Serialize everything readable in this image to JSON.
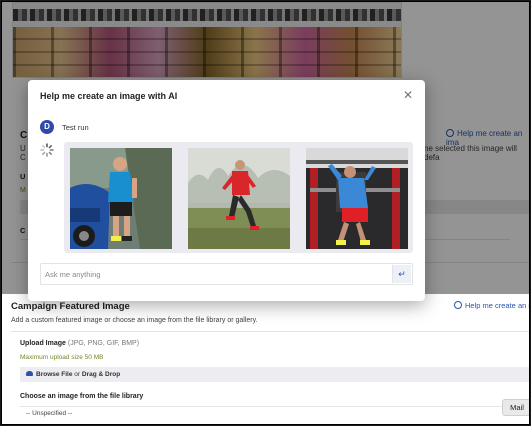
{
  "modal": {
    "title": "Help me create an image with AI",
    "close_icon": "close-icon",
    "user": {
      "avatar_letter": "D",
      "message": "Test run"
    },
    "loading_icon": "spinner-icon",
    "images": [
      {
        "subject": "runner-leaning-on-car"
      },
      {
        "subject": "runner-in-field"
      },
      {
        "subject": "athlete-with-barbell"
      }
    ],
    "input": {
      "placeholder": "Ask me anything",
      "value": ""
    },
    "send_icon": "enter-icon"
  },
  "background": {
    "section_heading_fragment": "C",
    "ai_link": "Help me create an ima",
    "side_text": "ne selected this image will defa",
    "left_fragments": [
      "U",
      "C",
      "U",
      "M",
      "C"
    ]
  },
  "featured": {
    "heading": "Campaign Featured Image",
    "description": "Add a custom featured image or choose an image from the file library or gallery.",
    "ai_link": "Help me create an im",
    "upload_label": "Upload Image",
    "upload_formats": "(JPG, PNG, GIF, BMP)",
    "max_size": "Maximum upload size 50 MB",
    "browse_label": "Browse File",
    "browse_or": "or",
    "drag_label": "Drag & Drop",
    "choose_label": "Choose an image from the file library",
    "select_value": "-- Unspecified --"
  },
  "tooltip": {
    "label": "Mail"
  },
  "colors": {
    "accent": "#2b54a8",
    "avatar": "#2f4aa8",
    "max_size_text": "#6f8a2a"
  }
}
